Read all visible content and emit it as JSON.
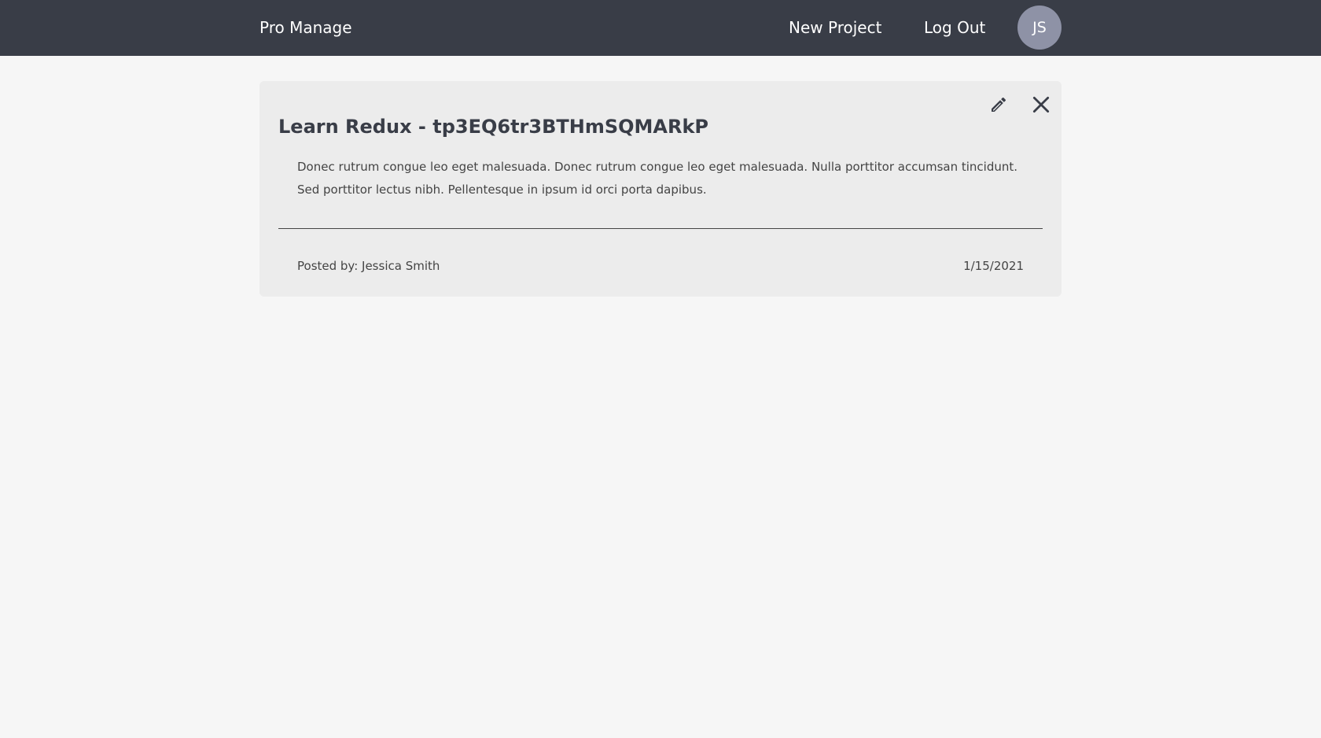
{
  "navbar": {
    "brand": "Pro Manage",
    "links": [
      {
        "label": "New Project"
      },
      {
        "label": "Log Out"
      }
    ],
    "avatar_initials": "JS",
    "background_color": "#393d47",
    "avatar_color": "#8e92a6"
  },
  "project": {
    "title": "Learn Redux - tp3EQ6tr3BTHmSQMARkP",
    "description": "Donec rutrum congue leo eget malesuada. Donec rutrum congue leo eget malesuada. Nulla porttitor accumsan tincidunt. Sed porttitor lectus nibh. Pellentesque in ipsum id orci porta dapibus.",
    "posted_by": "Posted by: Jessica Smith",
    "date": "1/15/2021",
    "actions": [
      {
        "icon": "pencil-icon"
      },
      {
        "icon": "close-icon"
      }
    ]
  }
}
